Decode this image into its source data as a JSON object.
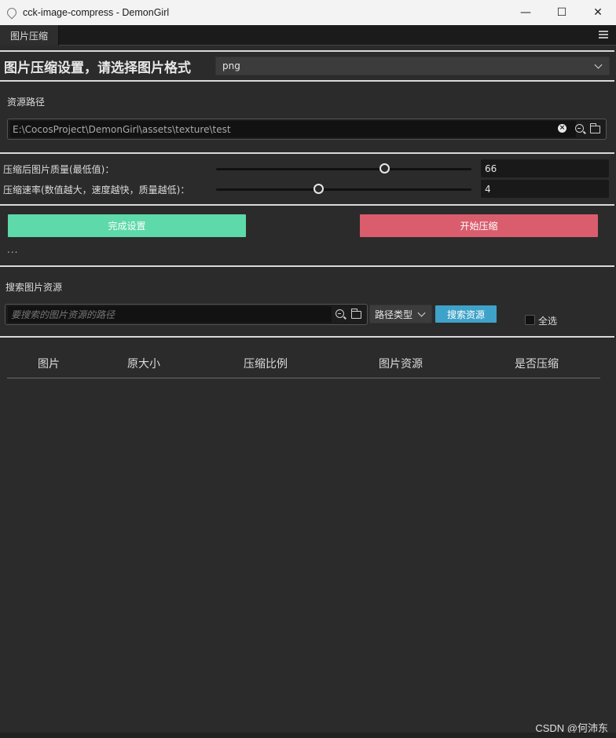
{
  "window": {
    "title": "cck-image-compress - DemonGirl",
    "min_glyph": "—",
    "max_glyph": "☐",
    "close_glyph": "✕"
  },
  "tabs": [
    {
      "label": "图片压缩"
    }
  ],
  "settings": {
    "title": "图片压缩设置，请选择图片格式",
    "format_value": "png"
  },
  "resource_path": {
    "label": "资源路径",
    "value": "E:\\CocosProject\\DemonGirl\\assets\\texture\\test"
  },
  "quality": {
    "label": "压缩后图片质量(最低值)：",
    "value": "66",
    "slider_fraction": 0.66
  },
  "speed": {
    "label": "压缩速率(数值越大，速度越快，质量越低)：",
    "value": "4",
    "slider_fraction": 0.4
  },
  "actions": {
    "finish_label": "完成设置",
    "start_label": "开始压缩",
    "status": "...",
    "finish_color": "#5ed9a9",
    "start_color": "#d95d6d"
  },
  "search": {
    "label": "搜索图片资源",
    "placeholder": "要搜索的图片资源的路径",
    "path_type_label": "路径类型",
    "search_button_label": "搜索资源",
    "search_button_color": "#3fa3c9",
    "select_all_label": "全选"
  },
  "table": {
    "columns": [
      "图片",
      "原大小",
      "压缩比例",
      "图片资源",
      "是否压缩"
    ]
  },
  "watermark": "CSDN @何沛东"
}
